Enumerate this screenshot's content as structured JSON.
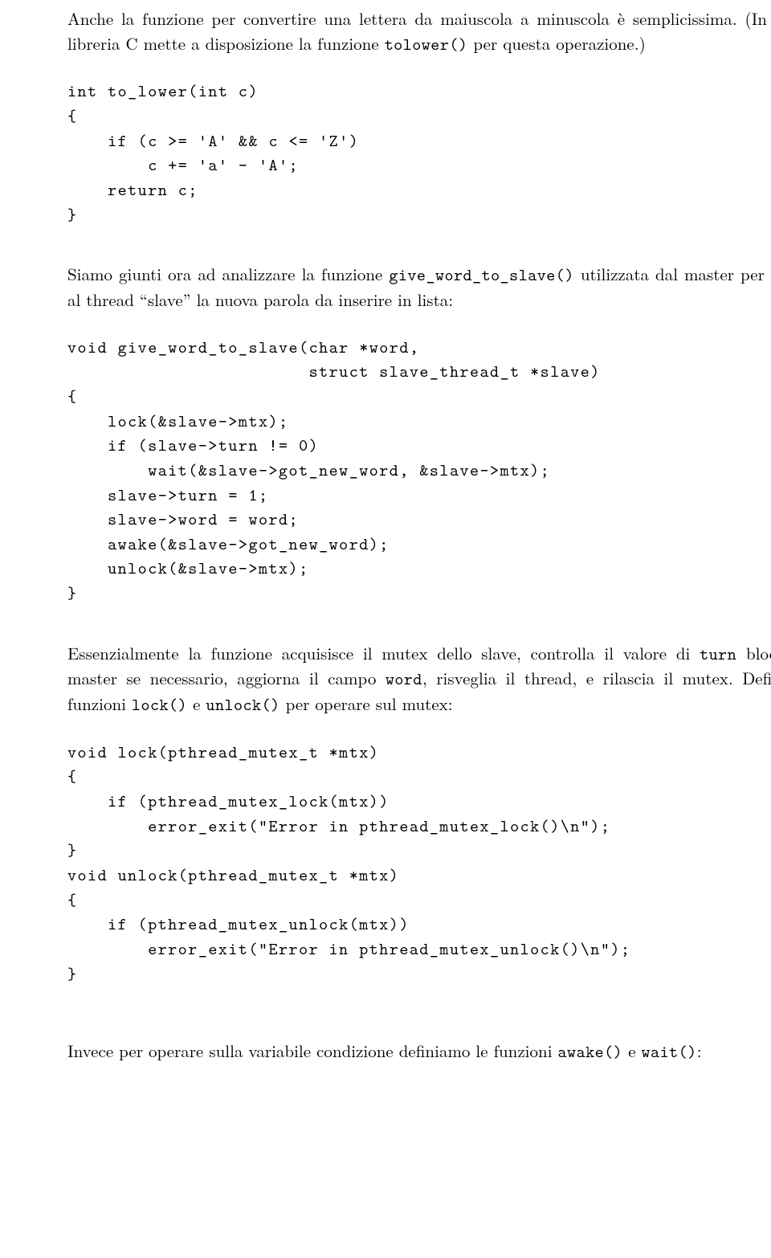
{
  "para1_a": "Anche la funzione per convertire una lettera da maiuscola a minuscola è semplicissima. (In effetti la libreria C mette a disposizione la funzione ",
  "para1_tt": "tolower()",
  "para1_b": " per questa operazione.)",
  "code1": "int to_lower(int c)\n{\n    if (c >= 'A' && c <= 'Z')\n        c += 'a' - 'A';\n    return c;\n}",
  "para2_a": "Siamo giunti ora ad analizzare la funzione ",
  "para2_tt": "give_word_to_slave()",
  "para2_b": " utilizzata dal master per segnalare al thread “slave” la nuova parola da inserire in lista:",
  "code2": "void give_word_to_slave(char *word,\n                        struct slave_thread_t *slave)\n{\n    lock(&slave->mtx);\n    if (slave->turn != 0)\n        wait(&slave->got_new_word, &slave->mtx);\n    slave->turn = 1;\n    slave->word = word;\n    awake(&slave->got_new_word);\n    unlock(&slave->mtx);\n}",
  "para3_a": "Essenzialmente la funzione acquisisce il mutex dello slave, controlla il valore di ",
  "para3_tt1": "turn",
  "para3_b": " bloccando il master se necessario, aggiorna il campo ",
  "para3_tt2": "word",
  "para3_c": ", risveglia il thread, e rilascia il mutex. Definiamo le funzioni ",
  "para3_tt3": "lock()",
  "para3_d": " e ",
  "para3_tt4": "unlock()",
  "para3_e": " per operare sul mutex:",
  "code3": "void lock(pthread_mutex_t *mtx)\n{\n    if (pthread_mutex_lock(mtx))\n        error_exit(\"Error in pthread_mutex_lock()\\n\");\n}\nvoid unlock(pthread_mutex_t *mtx)\n{\n    if (pthread_mutex_unlock(mtx))\n        error_exit(\"Error in pthread_mutex_unlock()\\n\");\n}",
  "para4_a": "Invece per operare sulla variabile condizione definiamo le funzioni ",
  "para4_tt1": "awake()",
  "para4_b": " e ",
  "para4_tt2": "wait()",
  "para4_c": ":"
}
